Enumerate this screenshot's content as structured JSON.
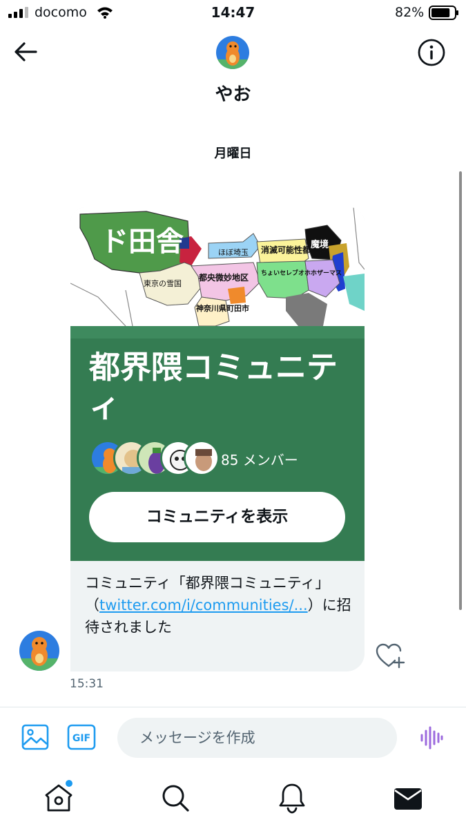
{
  "status_bar": {
    "carrier": "docomo",
    "time": "14:47",
    "battery_percent": "82%",
    "battery_level": 0.82
  },
  "header": {
    "back_icon": "back-arrow-icon",
    "name": "やお",
    "info_icon": "info-icon"
  },
  "conversation": {
    "date_label": "月曜日",
    "card": {
      "map_labels": [
        "ド田舎",
        "ほぼ埼玉",
        "消滅可能性都市群",
        "魔境",
        "東京の雪国",
        "都央微妙地区",
        "ちょいセレブオホホザーマス",
        "神奈川県町田市"
      ],
      "title": "都界隈コミュニティ",
      "member_count": "85 メンバー",
      "button_label": "コミュニティを表示",
      "message_prefix": "コミュニティ「都界隈コミュニティ」（",
      "message_link": "twitter.com/i/communities/...",
      "message_suffix": "）に招待されました"
    },
    "timestamp": "15:31",
    "reaction_icon": "heart-plus-icon"
  },
  "composer": {
    "placeholder": "メッセージを作成",
    "gif_label": "GIF"
  },
  "colors": {
    "accent": "#1d9bf0",
    "community_green": "#347c52",
    "voice_purple": "#9c6ade"
  }
}
